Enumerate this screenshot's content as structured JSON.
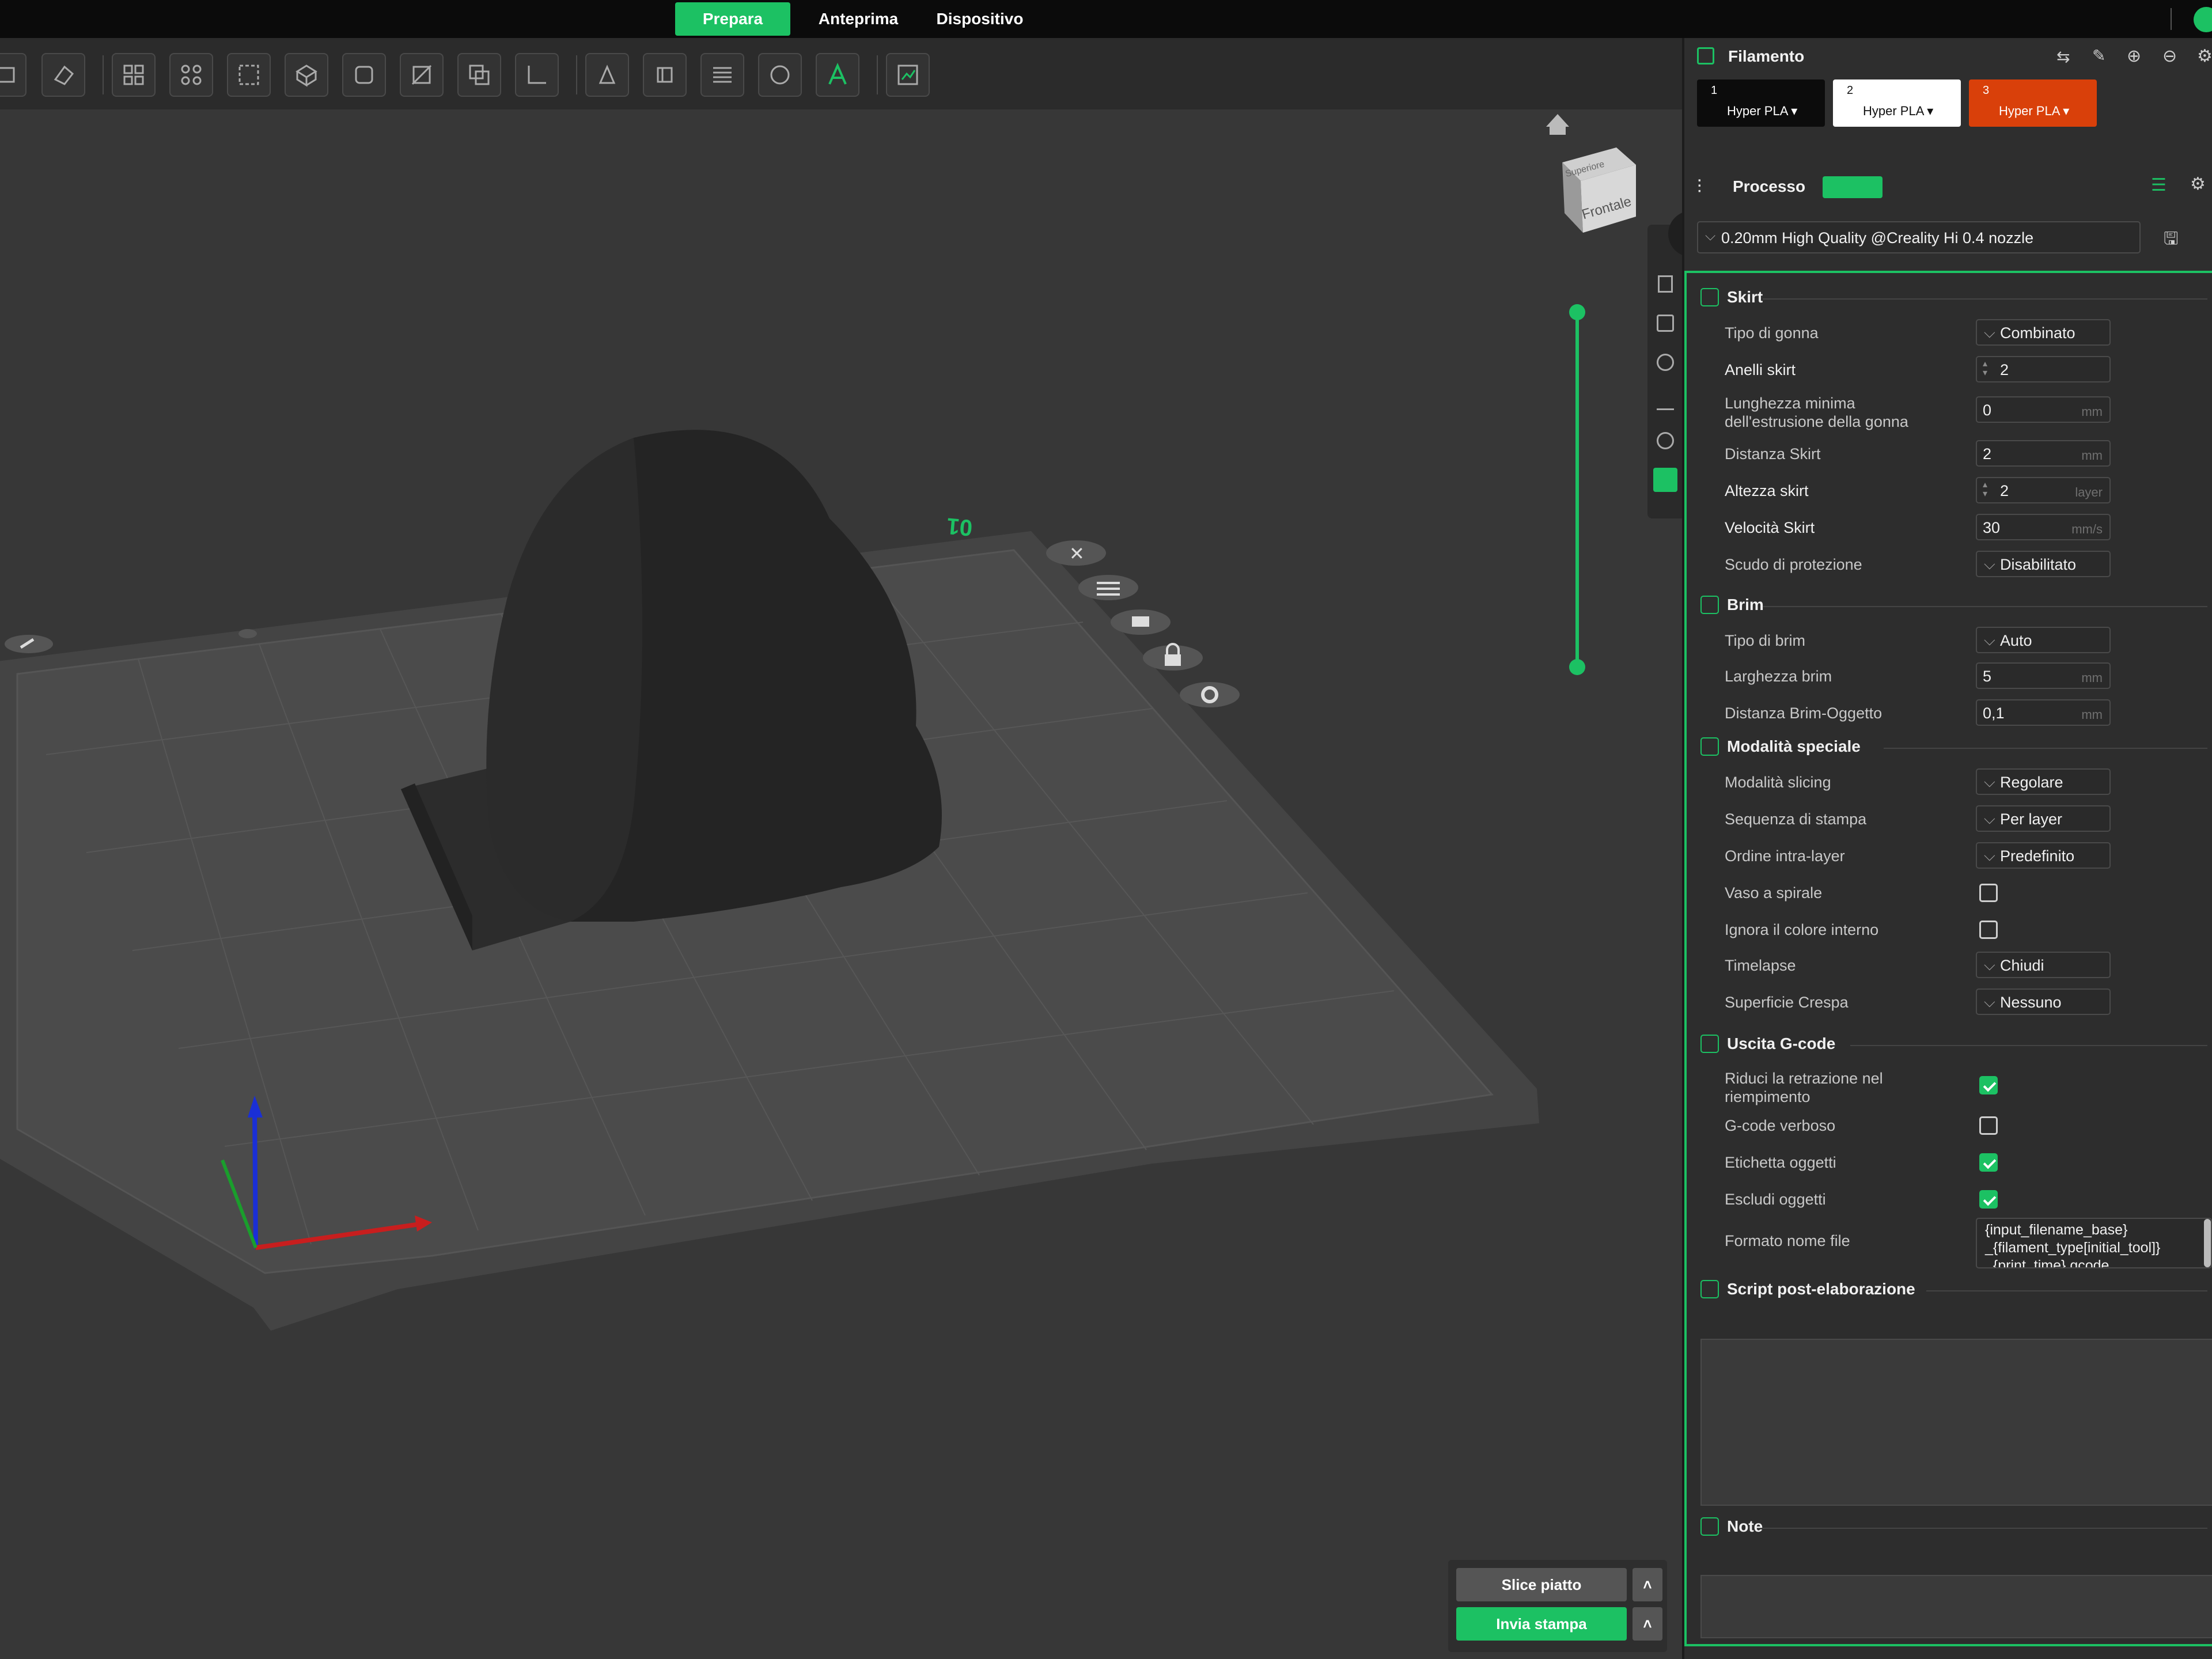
{
  "top_tabs": [
    "Prepara",
    "Anteprima",
    "Dispositivo"
  ],
  "viewport": {
    "plate_label": "01",
    "view_cube": {
      "top": "Superiore",
      "front": "Frontale"
    }
  },
  "bottom": {
    "slice_label": "Slice piatto",
    "print_label": "Invia stampa",
    "arrow": "˄"
  },
  "filament": {
    "title": "Filamento",
    "slots": [
      {
        "num": "1",
        "type": "Hyper PLA ▾",
        "color": "#0c0c0c",
        "text_color": "#ffffff"
      },
      {
        "num": "2",
        "type": "Hyper PLA ▾",
        "color": "#ffffff",
        "text_color": "#111111"
      },
      {
        "num": "3",
        "type": "Hyper PLA ▾",
        "color": "#d9400a",
        "text_color": "#ffffff"
      }
    ]
  },
  "process": {
    "title": "Processo",
    "preset": "0.20mm High Quality @Creality Hi 0.4 nozzle"
  },
  "sections": {
    "skirt": "Skirt",
    "brim": "Brim",
    "special": "Modalità speciale",
    "gcode": "Uscita G-code",
    "post": "Script post-elaborazione",
    "notes": "Note"
  },
  "skirt_rows": [
    {
      "label": "Tipo di gonna",
      "value": "Combinato",
      "kind": "select"
    },
    {
      "label": "Anelli skirt",
      "value": "2",
      "kind": "spin"
    },
    {
      "label": "Lunghezza minima\ndell'estrusione della gonna",
      "value": "0",
      "unit": "mm",
      "kind": "num"
    },
    {
      "label": "Distanza Skirt",
      "value": "2",
      "unit": "mm",
      "kind": "num"
    },
    {
      "label": "Altezza skirt",
      "value": "2",
      "unit": "layer",
      "kind": "spin"
    },
    {
      "label": "Velocità Skirt",
      "value": "30",
      "unit": "mm/s",
      "kind": "num"
    },
    {
      "label": "Scudo di protezione",
      "value": "Disabilitato",
      "kind": "select"
    }
  ],
  "brim_rows": [
    {
      "label": "Tipo di brim",
      "value": "Auto",
      "kind": "select"
    },
    {
      "label": "Larghezza brim",
      "value": "5",
      "unit": "mm",
      "kind": "num"
    },
    {
      "label": "Distanza Brim-Oggetto",
      "value": "0,1",
      "unit": "mm",
      "kind": "num"
    }
  ],
  "special_rows": [
    {
      "label": "Modalità slicing",
      "value": "Regolare",
      "kind": "select"
    },
    {
      "label": "Sequenza di stampa",
      "value": "Per layer",
      "kind": "select"
    },
    {
      "label": "Ordine intra-layer",
      "value": "Predefinito",
      "kind": "select"
    },
    {
      "label": "Vaso a spirale",
      "checked": false,
      "kind": "check"
    },
    {
      "label": "Ignora il colore interno",
      "checked": false,
      "kind": "check"
    },
    {
      "label": "Timelapse",
      "value": "Chiudi",
      "kind": "select"
    },
    {
      "label": "Superficie Crespa",
      "value": "Nessuno",
      "kind": "select"
    }
  ],
  "gcode_rows": [
    {
      "label": "Riduci la retrazione nel\nriempimento",
      "checked": true,
      "kind": "check"
    },
    {
      "label": "G-code verboso",
      "checked": false,
      "kind": "check"
    },
    {
      "label": "Etichetta oggetti",
      "checked": true,
      "kind": "check"
    },
    {
      "label": "Escludi oggetti",
      "checked": true,
      "kind": "check"
    }
  ],
  "filename_format": {
    "label": "Formato nome file",
    "value": "{input_filename_base}\n_{filament_type[initial_tool]}\n_{print_time}.gcode"
  },
  "colors": {
    "accent": "#1cc163",
    "filament3": "#d9400a"
  }
}
